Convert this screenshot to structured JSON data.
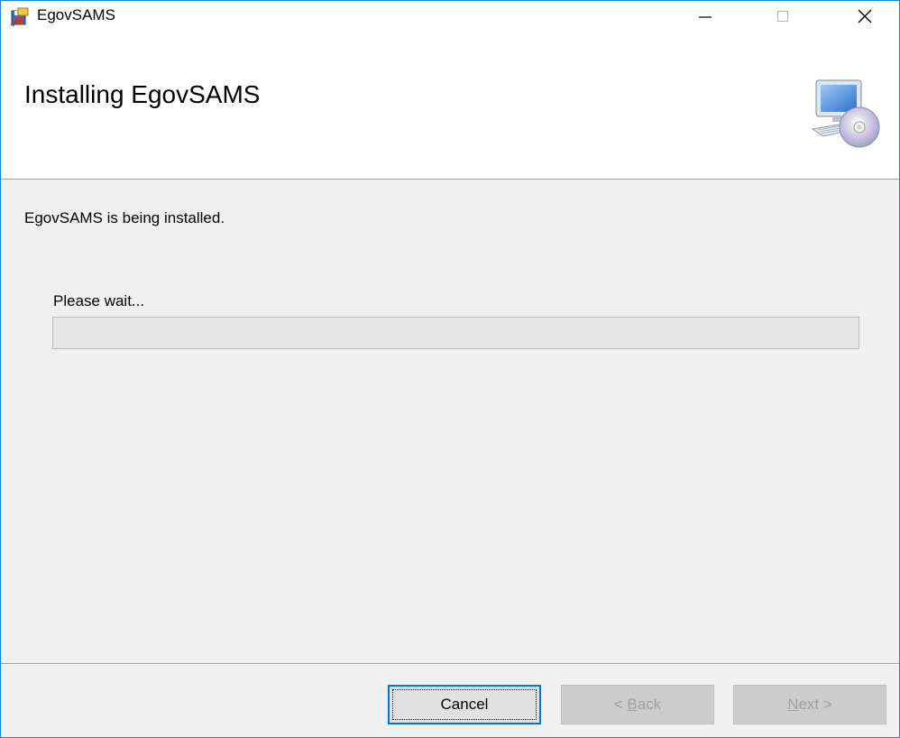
{
  "window": {
    "title": "EgovSAMS",
    "minimize_glyph": "—",
    "maximize_glyph": "☐",
    "close_glyph": "✕"
  },
  "banner": {
    "title": "Installing EgovSAMS",
    "icon": "computer-disc-icon"
  },
  "body": {
    "status": "EgovSAMS is being installed.",
    "wait_label": "Please wait...",
    "progress": 0
  },
  "buttons": {
    "cancel": "Cancel",
    "back_prefix": "< ",
    "back_accel": "B",
    "back_rest": "ack",
    "next_accel": "N",
    "next_rest": "ext >"
  },
  "colors": {
    "window_border": "#1883d7",
    "progress_fill": "#06b025",
    "focus_border": "#0078d7"
  }
}
